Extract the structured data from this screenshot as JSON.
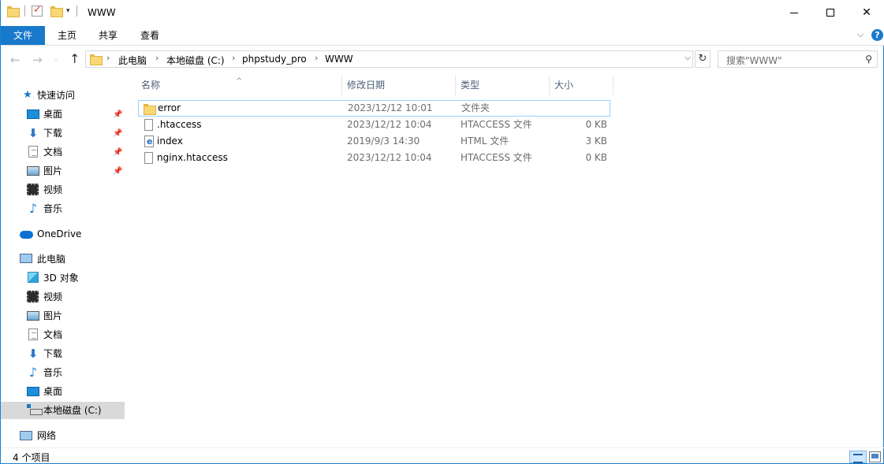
{
  "window": {
    "title": "WWW"
  },
  "ribbon": {
    "tabs": [
      {
        "label": "文件",
        "active": true
      },
      {
        "label": "主页"
      },
      {
        "label": "共享"
      },
      {
        "label": "查看"
      }
    ]
  },
  "address": {
    "crumbs": [
      "此电脑",
      "本地磁盘 (C:)",
      "phpstudy_pro",
      "WWW"
    ],
    "separator": "›"
  },
  "search": {
    "placeholder": "搜索\"WWW\""
  },
  "sidebar": {
    "quick_access": "快速访问",
    "quick_items": [
      {
        "label": "桌面",
        "icon": "desktop-icon",
        "pinned": true
      },
      {
        "label": "下载",
        "icon": "download-icon",
        "pinned": true
      },
      {
        "label": "文档",
        "icon": "document-icon",
        "pinned": true
      },
      {
        "label": "图片",
        "icon": "picture-icon",
        "pinned": true
      },
      {
        "label": "视频",
        "icon": "video-icon"
      },
      {
        "label": "音乐",
        "icon": "music-icon"
      }
    ],
    "onedrive": "OneDrive",
    "this_pc": "此电脑",
    "pc_items": [
      {
        "label": "3D 对象",
        "icon": "3d-objects-icon"
      },
      {
        "label": "视频",
        "icon": "video-icon"
      },
      {
        "label": "图片",
        "icon": "picture-icon"
      },
      {
        "label": "文档",
        "icon": "document-icon"
      },
      {
        "label": "下载",
        "icon": "download-icon"
      },
      {
        "label": "音乐",
        "icon": "music-icon"
      },
      {
        "label": "桌面",
        "icon": "desktop-icon"
      },
      {
        "label": "本地磁盘 (C:)",
        "icon": "drive-icon",
        "selected": true
      }
    ],
    "network": "网络"
  },
  "list": {
    "columns": {
      "name": "名称",
      "date": "修改日期",
      "type": "类型",
      "size": "大小"
    },
    "rows": [
      {
        "name": "error",
        "date": "2023/12/12 10:01",
        "type": "文件夹",
        "size": "",
        "icon": "folder-icon"
      },
      {
        "name": ".htaccess",
        "date": "2023/12/12 10:04",
        "type": "HTACCESS 文件",
        "size": "0 KB",
        "icon": "file-icon"
      },
      {
        "name": "index",
        "date": "2019/9/3 14:30",
        "type": "HTML 文件",
        "size": "3 KB",
        "icon": "html-file-icon"
      },
      {
        "name": "nginx.htaccess",
        "date": "2023/12/12 10:04",
        "type": "HTACCESS 文件",
        "size": "0 KB",
        "icon": "file-icon"
      }
    ]
  },
  "status": {
    "item_count": "4 个项目"
  },
  "colors": {
    "accent": "#1979ca",
    "selection": "#d9d9d9",
    "focus_border": "#99d1ff"
  }
}
